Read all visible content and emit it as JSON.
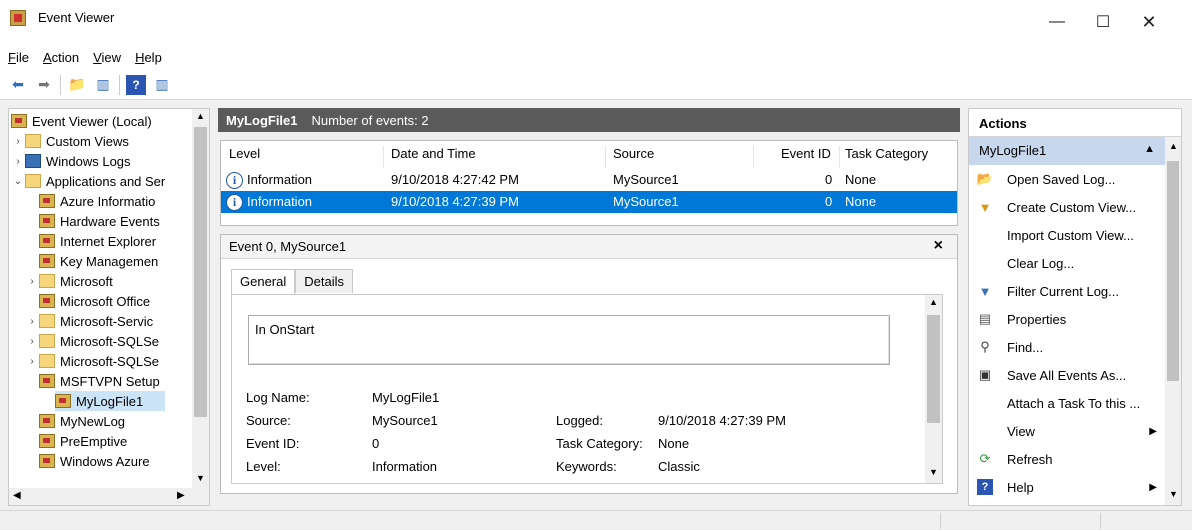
{
  "window": {
    "title": "Event Viewer",
    "minimize": "—",
    "maximize": "☐",
    "close": "✕"
  },
  "menu": [
    {
      "key": "F",
      "rest": "ile"
    },
    {
      "key": "A",
      "rest": "ction"
    },
    {
      "key": "V",
      "rest": "iew"
    },
    {
      "key": "H",
      "rest": "elp"
    }
  ],
  "tree": {
    "items": [
      {
        "label": "Event Viewer (Local)",
        "arrow": "",
        "icon": "log"
      },
      {
        "label": "Custom Views",
        "arrow": "›",
        "icon": "folder"
      },
      {
        "label": "Windows Logs",
        "arrow": "›",
        "icon": "winlogs"
      },
      {
        "label": "Applications and Ser",
        "arrow": "⌄",
        "icon": "folder"
      },
      {
        "label": "Azure Informatio",
        "arrow": "",
        "icon": "log"
      },
      {
        "label": "Hardware Events",
        "arrow": "",
        "icon": "log"
      },
      {
        "label": "Internet Explorer",
        "arrow": "",
        "icon": "log"
      },
      {
        "label": "Key Managemen",
        "arrow": "",
        "icon": "log"
      },
      {
        "label": "Microsoft",
        "arrow": "›",
        "icon": "folder"
      },
      {
        "label": "Microsoft Office",
        "arrow": "",
        "icon": "log"
      },
      {
        "label": "Microsoft-Servic",
        "arrow": "›",
        "icon": "folder"
      },
      {
        "label": "Microsoft-SQLSe",
        "arrow": "›",
        "icon": "folder"
      },
      {
        "label": "Microsoft-SQLSe",
        "arrow": "›",
        "icon": "folder"
      },
      {
        "label": "MSFTVPN Setup",
        "arrow": "",
        "icon": "log"
      },
      {
        "label": "MyLogFile1",
        "arrow": "",
        "icon": "log",
        "selected": true
      },
      {
        "label": "MyNewLog",
        "arrow": "",
        "icon": "log"
      },
      {
        "label": "PreEmptive",
        "arrow": "",
        "icon": "log"
      },
      {
        "label": "Windows Azure",
        "arrow": "",
        "icon": "log"
      }
    ]
  },
  "center": {
    "log_name": "MyLogFile1",
    "event_count": "Number of events: 2",
    "columns": [
      "Level",
      "Date and Time",
      "Source",
      "Event ID",
      "Task Category"
    ],
    "rows": [
      {
        "level": "Information",
        "date": "9/10/2018 4:27:42 PM",
        "source": "MySource1",
        "event_id": "0",
        "task": "None"
      },
      {
        "level": "Information",
        "date": "9/10/2018 4:27:39 PM",
        "source": "MySource1",
        "event_id": "0",
        "task": "None",
        "selected": true
      }
    ]
  },
  "detail": {
    "title": "Event 0, MySource1",
    "close": "×",
    "tabs": [
      "General",
      "Details"
    ],
    "message": "In OnStart",
    "log_name_label": "Log Name:",
    "log_name_value": "MyLogFile1",
    "source_label": "Source:",
    "source_value": "MySource1",
    "logged_label": "Logged:",
    "logged_value": "9/10/2018 4:27:39 PM",
    "event_id_label": "Event ID:",
    "event_id_value": "0",
    "task_category_label": "Task Category:",
    "task_category_value": "None",
    "level_label": "Level:",
    "level_value": "Information",
    "keywords_label": "Keywords:",
    "keywords_value": "Classic"
  },
  "actions": {
    "header": "Actions",
    "section": "MyLogFile1",
    "items": [
      {
        "label": "Open Saved Log...",
        "icon": "open-folder-icon",
        "glyph": "📂"
      },
      {
        "label": "Create Custom View...",
        "icon": "funnel-star-icon",
        "glyph": "▼"
      },
      {
        "label": "Import Custom View...",
        "icon": "",
        "glyph": ""
      },
      {
        "label": "Clear Log...",
        "icon": "",
        "glyph": ""
      },
      {
        "label": "Filter Current Log...",
        "icon": "filter-icon",
        "glyph": "▼"
      },
      {
        "label": "Properties",
        "icon": "properties-icon",
        "glyph": "▤"
      },
      {
        "label": "Find...",
        "icon": "binoculars-icon",
        "glyph": "⚲"
      },
      {
        "label": "Save All Events As...",
        "icon": "save-icon",
        "glyph": "▣"
      },
      {
        "label": "Attach a Task To this ...",
        "icon": "",
        "glyph": ""
      },
      {
        "label": "View",
        "icon": "",
        "glyph": "",
        "submenu": true
      },
      {
        "label": "Refresh",
        "icon": "refresh-icon",
        "glyph": "⟳"
      },
      {
        "label": "Help",
        "icon": "help-icon",
        "glyph": "?",
        "submenu": true
      }
    ]
  },
  "colors": {
    "selection_blue": "#0078d7",
    "header_dark": "#5a5a5a",
    "actions_section": "#c7d7ee"
  }
}
